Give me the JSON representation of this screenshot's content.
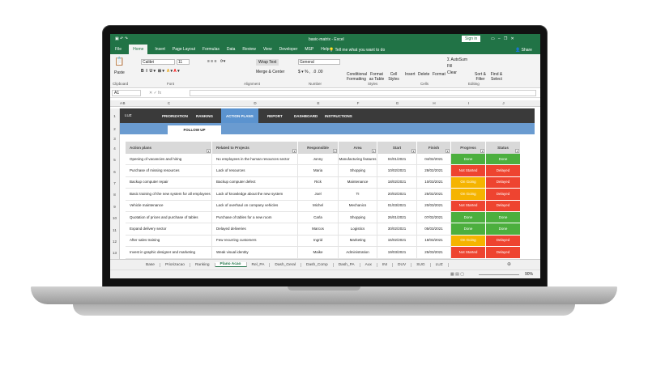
{
  "window": {
    "title": "basic-matrix - Excel",
    "sign_in": "Sign in",
    "share": "Share"
  },
  "menu_tabs": [
    "File",
    "Home",
    "Insert",
    "Page Layout",
    "Formulas",
    "Data",
    "Review",
    "View",
    "Developer",
    "MSP",
    "Help"
  ],
  "tell_me": "Tell me what you want to do",
  "ribbon": {
    "paste": "Paste",
    "clipboard": "Clipboard",
    "font_name": "Calibri",
    "font_size": "11",
    "font": "Font",
    "wrap_text": "Wrap Text",
    "merge_center": "Merge & Center",
    "alignment": "Alignment",
    "number_format": "General",
    "number": "Number",
    "cond_format": "Conditional Formatting",
    "format_table": "Format as Table",
    "cell_styles": "Cell Styles",
    "styles": "Styles",
    "insert": "Insert",
    "delete": "Delete",
    "format": "Format",
    "cells": "Cells",
    "autosum": "AutoSum",
    "fill": "Fill",
    "clear": "Clear",
    "sort_filter": "Sort & Filter",
    "find_select": "Find & Select",
    "editing": "Editing"
  },
  "name_box": "A1",
  "columns": [
    "A",
    "B",
    "C",
    "D",
    "E",
    "F",
    "G",
    "H",
    "I",
    "J"
  ],
  "nav": {
    "logo": "LUZ",
    "items": [
      "PRIORIZATION",
      "RANKING",
      "ACTION PLANS",
      "REPORT",
      "DASHBOARD",
      "INSTRUCTIONS"
    ],
    "sub": "FOLLOW UP"
  },
  "table": {
    "headers": [
      "Action plans",
      "Related to Projects",
      "Responsible",
      "Area",
      "Start",
      "Finish",
      "Progress",
      "Status"
    ],
    "rows": [
      [
        "Opening of vacancies and hiring",
        "No employees in the human resources sector",
        "Jonny",
        "Manufacturing features",
        "04/01/2021",
        "04/02/2021",
        "Done",
        "Done"
      ],
      [
        "Purchase of missing resources",
        "Lack of resources",
        "Maria",
        "Shopping",
        "10/02/2021",
        "28/02/2021",
        "Not Started",
        "Delayed"
      ],
      [
        "Backup computer repair",
        "Backup computer defect",
        "Rick",
        "Maintenance",
        "18/02/2021",
        "10/03/2021",
        "On Going",
        "Delayed"
      ],
      [
        "Basic training of the new system for all employees",
        "Lack of knowledge about the new system",
        "Joel",
        "TI",
        "20/02/2021",
        "25/02/2021",
        "On Going",
        "Delayed"
      ],
      [
        "Vehicle maintenance",
        "Lack of overhaul on company vehicles",
        "Michel",
        "Mechanics",
        "01/03/2021",
        "20/03/2021",
        "Not Started",
        "Delayed"
      ],
      [
        "Quotation of prices and purchase of tables",
        "Purchase of tables for a new room",
        "Carla",
        "Shopping",
        "26/01/2021",
        "07/02/2021",
        "Done",
        "Done"
      ],
      [
        "Expand delivery sector",
        "Delayed deliveries",
        "Marcos",
        "Logistics",
        "30/02/2021",
        "05/03/2021",
        "Done",
        "Done"
      ],
      [
        "After sales training",
        "Few recurring customers",
        "Ingrid",
        "Marketing",
        "15/02/2021",
        "18/03/2021",
        "On Going",
        "Delayed"
      ],
      [
        "Invest in graphic designer and marketing",
        "Weak visual identity",
        "Maike",
        "Administration",
        "19/03/2021",
        "25/03/2021",
        "Not Started",
        "Delayed"
      ]
    ]
  },
  "colors": {
    "Done": "#4caf3e",
    "Not Started": "#ee4430",
    "On Going": "#f5b400",
    "Delayed": "#ee4430"
  },
  "sheet_tabs": [
    "Base",
    "Priorizacao",
    "Ranking",
    "Plano Acao",
    "Rel_PA",
    "Dash_Geral",
    "Dash_Comp",
    "Dash_PA",
    "Aux",
    "INI",
    "DUV",
    "SUG",
    "LUZ"
  ],
  "active_sheet": "Plano Acao",
  "zoom": "90%"
}
